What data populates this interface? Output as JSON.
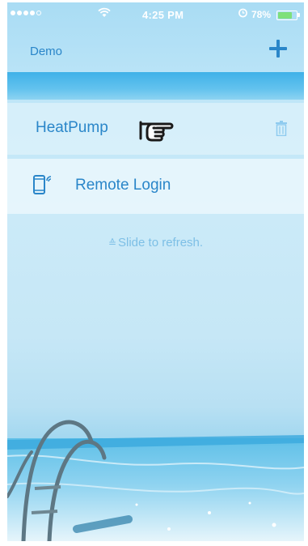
{
  "status_bar": {
    "time": "4:25 PM",
    "battery_percent": "78%",
    "battery_level": 0.78
  },
  "nav": {
    "title": "Demo",
    "add_icon": "plus-icon"
  },
  "devices": [
    {
      "name": "HeatPump",
      "icons": [
        "pointing-hand-icon",
        "trash-icon"
      ]
    }
  ],
  "remote_login": {
    "label": "Remote Login",
    "icon": "phone-wifi-icon"
  },
  "refresh_hint": {
    "text": "Slide to refresh.",
    "icon": "down-arrows-icon"
  },
  "colors": {
    "accent": "#2a86c9",
    "band": "#3fb1e8",
    "hint": "#7dbfe6"
  }
}
